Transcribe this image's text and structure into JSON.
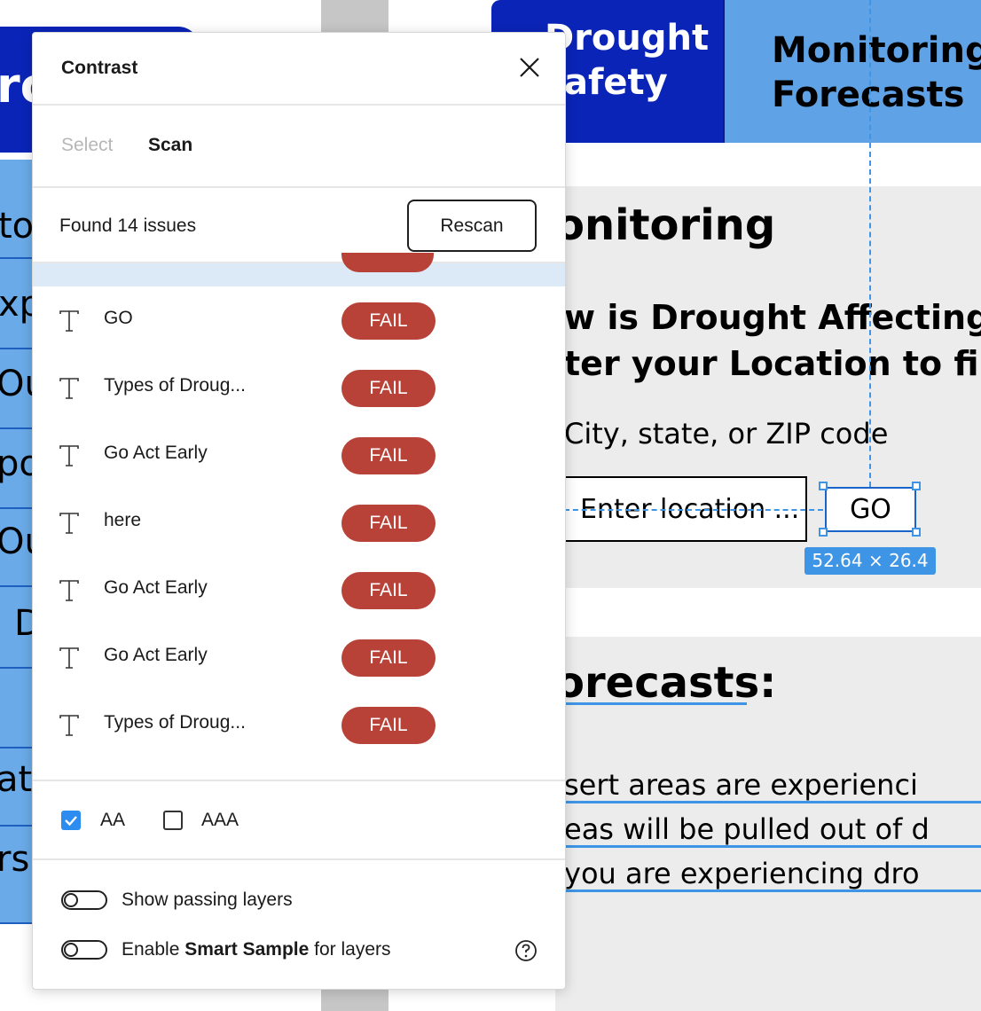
{
  "background": {
    "header_tiles": [
      {
        "lines": [
          "Drought",
          "afety"
        ]
      },
      {
        "lines": [
          "Monitoring,",
          "Forecasts"
        ]
      }
    ],
    "hero_partial": "ro",
    "sidebar_fragments": [
      "to",
      "xp",
      "Ou",
      "po",
      "Ou",
      "D",
      "",
      "at",
      "rs"
    ],
    "monitoring_heading": "onitoring",
    "question_line1": "w is Drought Affecting",
    "question_line2": "ter your Location to fin",
    "location_label": "City, state, or ZIP code",
    "location_placeholder": "Enter location ...",
    "go_label": "GO",
    "selection_dims": "52.64 × 26.4",
    "forecasts_heading": "orecasts:",
    "forecast_lines": [
      "sert areas are experienci",
      "eas will be pulled out of d",
      "you are experiencing dro"
    ]
  },
  "panel": {
    "title": "Contrast",
    "tabs": {
      "select": "Select",
      "scan": "Scan"
    },
    "found_text": "Found 14 issues",
    "rescan_label": "Rescan",
    "issues": [
      {
        "label": "GO",
        "status": "FAIL"
      },
      {
        "label": "Types of Droug...",
        "status": "FAIL"
      },
      {
        "label": "Go Act Early",
        "status": "FAIL"
      },
      {
        "label": "here",
        "status": "FAIL"
      },
      {
        "label": "Go Act Early",
        "status": "FAIL"
      },
      {
        "label": "Go Act Early",
        "status": "FAIL"
      },
      {
        "label": "Types of Droug...",
        "status": "FAIL"
      }
    ],
    "levels": {
      "aa": "AA",
      "aaa": "AAA",
      "aa_checked": true,
      "aaa_checked": false
    },
    "toggles": {
      "show_passing": "Show passing layers",
      "smart_pre": "Enable ",
      "smart_bold": "Smart Sample",
      "smart_post": " for layers"
    },
    "colors": {
      "fail": "#b84237",
      "accent": "#2d8cf0",
      "nav_blue": "#0a24b8"
    }
  }
}
